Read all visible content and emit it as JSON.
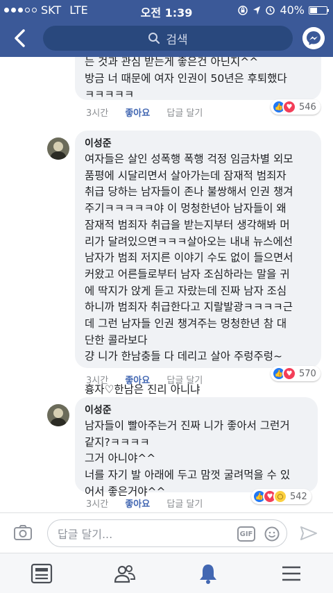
{
  "status_bar": {
    "carrier": "SKT",
    "network": "LTE",
    "time": "오전 1:39",
    "battery": "40%"
  },
  "nav": {
    "search_placeholder": "검색",
    "icons": [
      "back-icon",
      "search-icon",
      "messenger-icon"
    ]
  },
  "comments": [
    {
      "author": "",
      "text": "는 것과 관심 받는게 좋은건 아닌지^^\n방금 너 때문에 여자 인권이 50년은 후퇴했다\nㅋㅋㅋㅋㅋ",
      "time": "3시간",
      "like_label": "좋아요",
      "reply_label": "답글 달기",
      "reaction_count": "546",
      "reactions": [
        "like",
        "love"
      ]
    },
    {
      "author": "이성준",
      "text": "여자들은 살인 성폭행 폭행 걱정 임금차별 외모\n품평에 시달리면서 살아가는데 잠재적 범죄자\n취급 당하는 남자들이 존나 불쌍해서 인권 챙겨\n주기ㅋㅋㅋㅋㅋ야 이 멍청한년아 남자들이 왜\n잠재적 범죄자 취급을 받는지부터 생각해봐 머\n리가 달려있으면ㅋㅋㅋ살아오는 내내 뉴스에선\n남자가 범죄 저지른 이야기 수도 없이 들으면서\n커왔고 어른들로부터 남자 조심하라는 말을 귀\n에 딱지가 앉게 듣고 자랐는데 진짜 남자 조심\n하니까 범죄자 취급한다고 지랄발광ㅋㅋㅋㅋ근\n데 그런 남자들 인권 챙겨주는 멍청한년 참 대\n단한 콜라보다\n걍 니가 한남충들 다 데리고 살아 주렁주렁~\n\n흉자♡한남은 진리 아니냐",
      "time": "3시간",
      "like_label": "좋아요",
      "reply_label": "답글 달기",
      "reaction_count": "570",
      "reactions": [
        "like",
        "love"
      ]
    },
    {
      "author": "이성준",
      "text": "남자들이 빨아주는거 진짜 니가 좋아서 그런거\n같지?ㅋㅋㅋㅋ\n그거 아니야^^\n너를 자기 발 아래에 두고 맘껏 굴려먹을 수 있\n어서 좋은거야^^",
      "time": "3시간",
      "like_label": "좋아요",
      "reply_label": "답글 달기",
      "reaction_count": "542",
      "reactions": [
        "like",
        "love",
        "wow"
      ]
    }
  ],
  "composer": {
    "placeholder": "답글 달기...",
    "gif_label": "GIF"
  },
  "tab_bar": {
    "tabs": [
      "news-feed-icon",
      "friends-icon",
      "notifications-icon",
      "menu-icon"
    ],
    "active_tab": "notifications-icon"
  },
  "colors": {
    "brand": "#3b5998",
    "link": "#4267b2",
    "active_tab": "#4267b2",
    "bubble": "#f0f2f5"
  }
}
